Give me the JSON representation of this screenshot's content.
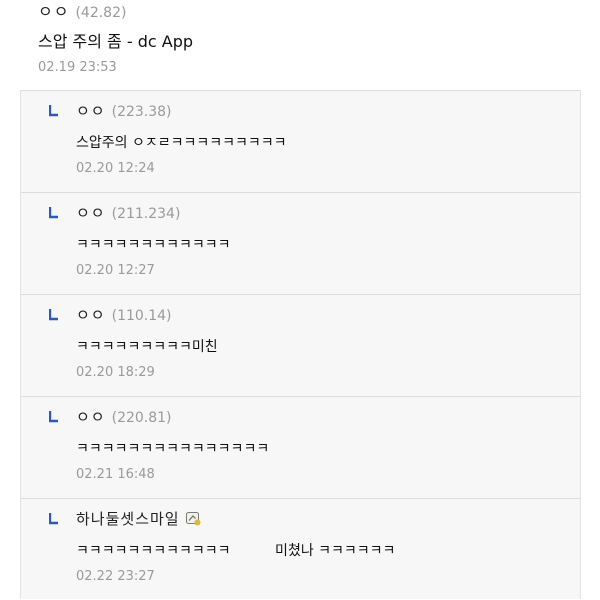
{
  "main_comment": {
    "nickname": "ㅇㅇ",
    "ip": "(42.82)",
    "text": "스압 주의 좀 - dc App",
    "date": "02.19 23:53"
  },
  "replies": [
    {
      "nickname": "ㅇㅇ",
      "ip": "(223.38)",
      "text": "스압주의 ㅇㅈㄹㅋㅋㅋㅋㅋㅋㅋㅋㅋ",
      "date": "02.20 12:24"
    },
    {
      "nickname": "ㅇㅇ",
      "ip": "(211.234)",
      "text": "ㅋㅋㅋㅋㅋㅋㅋㅋㅋㅋㅋㅋ",
      "date": "02.20 12:27"
    },
    {
      "nickname": "ㅇㅇ",
      "ip": "(110.14)",
      "text": "ㅋㅋㅋㅋㅋㅋㅋㅋㅋ미친",
      "date": "02.20 18:29"
    },
    {
      "nickname": "ㅇㅇ",
      "ip": "(220.81)",
      "text": "ㅋㅋㅋㅋㅋㅋㅋㅋㅋㅋㅋㅋㅋㅋㅋ",
      "date": "02.21 16:48"
    },
    {
      "nickname": "하나둘셋스마일",
      "member_icon": "member-badge-icon",
      "text": "ㅋㅋㅋㅋㅋㅋㅋㅋㅋㅋㅋㅋ          미쳤나 ㅋㅋㅋㅋㅋㅋ",
      "date": "02.22 23:27"
    }
  ],
  "colors": {
    "reply_arrow": "#2b5bb8",
    "meta_gray": "#9a9a9a",
    "reply_bg": "#f7f7f7"
  }
}
